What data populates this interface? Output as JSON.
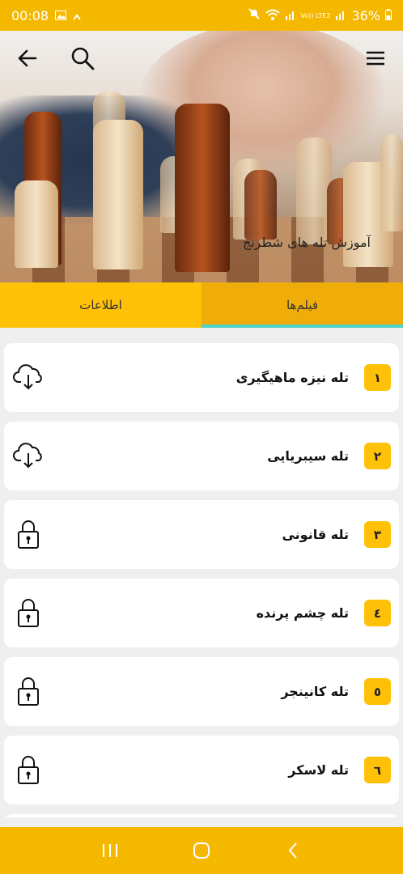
{
  "status_bar": {
    "time": "00:08",
    "battery": "36%",
    "network_label": "Vo)) LTE2"
  },
  "header": {
    "title": "آموزش تله های شطرنج"
  },
  "tabs": [
    {
      "label": "اطلاعات",
      "selected": false
    },
    {
      "label": "فیلم‌ها",
      "selected": true
    }
  ],
  "items": [
    {
      "number": "١",
      "title": "تله نیزه ماهیگیری",
      "icon": "download-cloud-icon"
    },
    {
      "number": "٢",
      "title": "تله سیبریایی",
      "icon": "download-cloud-icon"
    },
    {
      "number": "٣",
      "title": "تله قانونی",
      "icon": "lock-icon"
    },
    {
      "number": "٤",
      "title": "تله چشم پرنده",
      "icon": "lock-icon"
    },
    {
      "number": "٥",
      "title": "تله کانینجر",
      "icon": "lock-icon"
    },
    {
      "number": "٦",
      "title": "تله لاسکر",
      "icon": "lock-icon"
    }
  ],
  "colors": {
    "accent": "#ffc107",
    "status_bar": "#f5b800",
    "tab_indicator": "#4ed3c4"
  }
}
